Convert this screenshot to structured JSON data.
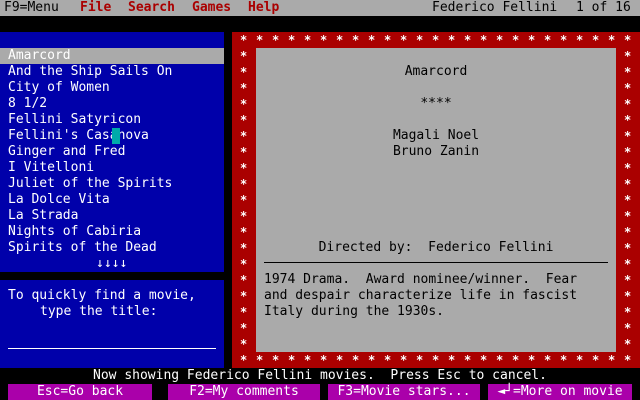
{
  "menubar": {
    "hotkey": "F9=Menu",
    "items": [
      "File",
      "Search",
      "Games",
      "Help"
    ],
    "context_title": "Federico Fellini",
    "page_indicator": "1 of 16"
  },
  "list": {
    "items": [
      "Amarcord",
      "And the Ship Sails On",
      "City of Women",
      "8 1/2",
      "Fellini Satyricon",
      "Fellini's Casanova",
      "Ginger and Fred",
      "I Vitelloni",
      "Juliet of the Spirits",
      "La Dolce Vita",
      "La Strada",
      "Nights of Cabiria",
      "Spirits of the Dead"
    ],
    "selected_index": 0,
    "more_arrows": "↓↓↓↓"
  },
  "help": {
    "line1": "To quickly find a movie,",
    "line2": "type the title:"
  },
  "detail": {
    "title": "Amarcord",
    "rating": "****",
    "cast": [
      "Magali Noel",
      "Bruno Zanin"
    ],
    "directed_label": "Directed by:",
    "director": "Federico Fellini",
    "description": [
      "1974 Drama.  Award nominee/winner.  Fear",
      "and despair characterize life in fascist",
      "Italy during the 1930s."
    ]
  },
  "status": {
    "message": "Now showing Federico Fellini movies.  Press Esc to cancel."
  },
  "fkeys": {
    "back": "Esc=Go back",
    "comments": "F2=My comments",
    "stars": "F3=Movie stars...",
    "more": "=More on movie"
  },
  "colors": {
    "dos_blue": "#0000aa",
    "dos_gray": "#aaaaaa",
    "dos_red": "#aa0000",
    "dos_magenta": "#aa00aa",
    "dos_cyan": "#00aaaa"
  }
}
